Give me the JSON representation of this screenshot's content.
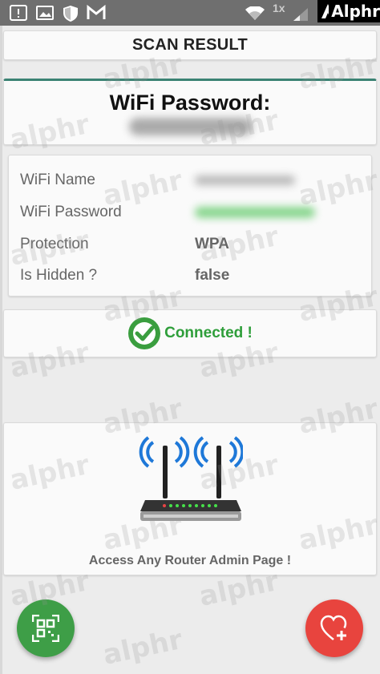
{
  "status_bar": {
    "signal_label": "1x",
    "brand": "Alphr",
    "icons": [
      "alert-icon",
      "image-icon",
      "shield-icon",
      "gmail-icon",
      "wifi-icon",
      "signal-icon"
    ]
  },
  "header": {
    "title": "SCAN RESULT"
  },
  "password_card": {
    "title": "WiFi Password:"
  },
  "info": {
    "rows": [
      {
        "label": "WiFi Name",
        "value": ""
      },
      {
        "label": "WiFi Password",
        "value": ""
      },
      {
        "label": "Protection",
        "value": "WPA"
      },
      {
        "label": "Is Hidden ?",
        "value": "false"
      }
    ]
  },
  "status": {
    "text": "Connected !",
    "color": "#2e9e3a"
  },
  "router_card": {
    "caption": "Access Any Router Admin Page !"
  },
  "fabs": {
    "scan_icon": "qr-scan-icon",
    "favorite_icon": "heart-plus-icon"
  },
  "watermark": "alphr",
  "colors": {
    "accent": "#3b8273",
    "scan_fab": "#3e9e47",
    "fav_fab": "#e8443e"
  }
}
